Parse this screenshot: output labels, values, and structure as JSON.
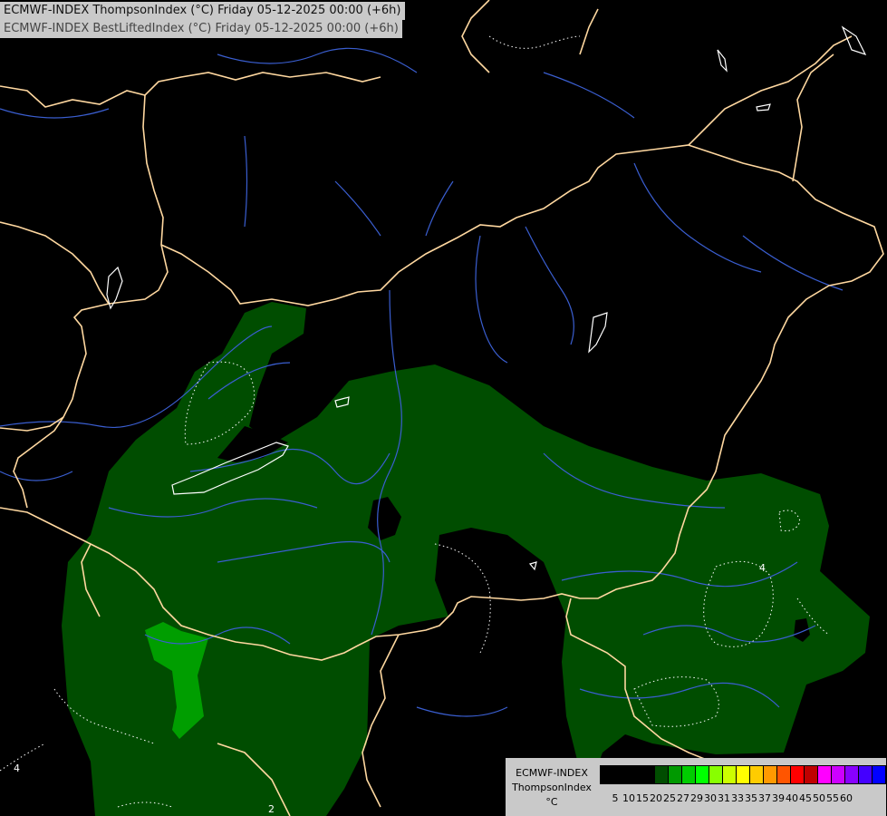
{
  "titles": {
    "line1": "ECMWF-INDEX ThompsonIndex (°C) Friday 05-12-2025 00:00 (+6h)",
    "line2": "ECMWF-INDEX BestLiftedIndex (°C) Friday 05-12-2025 00:00 (+6h)"
  },
  "contour_labels": [
    "4",
    "4",
    "2"
  ],
  "legend": {
    "model": "ECMWF-INDEX",
    "parameter": "ThompsonIndex",
    "unit": "°C",
    "levels": [
      "5",
      "10",
      "15",
      "20",
      "25",
      "27",
      "29",
      "30",
      "31",
      "33",
      "35",
      "37",
      "39",
      "40",
      "45",
      "50",
      "55",
      "60"
    ],
    "colors": [
      "#000000",
      "#000000",
      "#000000",
      "#000000",
      "#004d00",
      "#009900",
      "#00cc00",
      "#00ff00",
      "#88ff00",
      "#ccff00",
      "#ffff00",
      "#ffcc00",
      "#ff9900",
      "#ff5500",
      "#ff0000",
      "#c00000",
      "#ff00ff",
      "#cc00ff",
      "#8800ff",
      "#4400ff",
      "#0000ff"
    ]
  },
  "colors": {
    "background": "#000000",
    "thompson_25_27": "#004d00",
    "thompson_27_29": "#009e00",
    "border": "#ffd8a0",
    "river": "#3a5ed0",
    "lifted_index": "#ffffff"
  }
}
